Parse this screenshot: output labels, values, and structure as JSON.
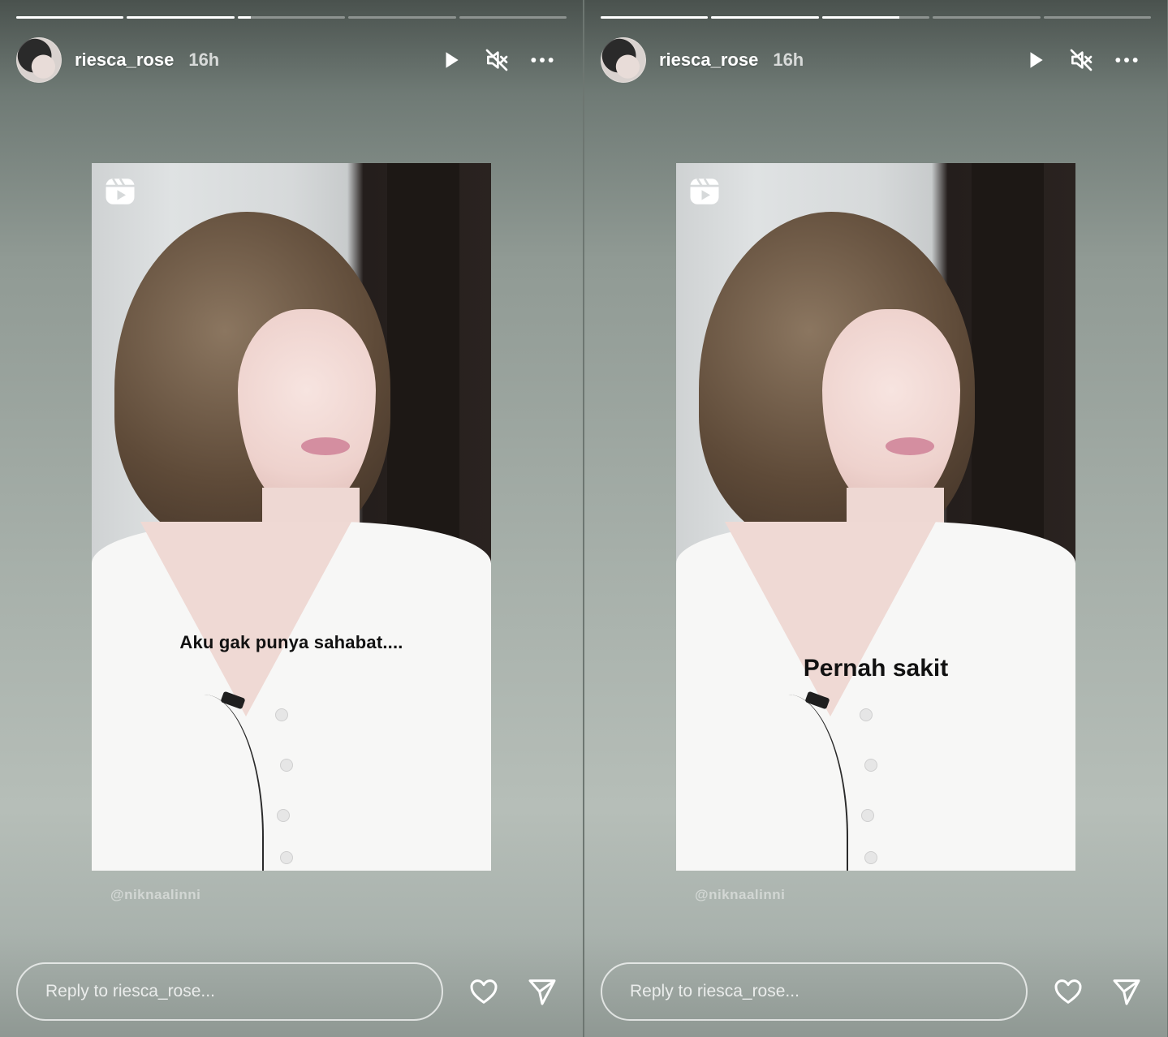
{
  "stories": [
    {
      "username": "riesca_rose",
      "time": "16h",
      "progress": [
        1,
        1,
        0.12,
        0,
        0
      ],
      "caption": "Aku gak punya sahabat....",
      "watermark": "@niknaalinni",
      "reply_placeholder": "Reply to riesca_rose...",
      "icons": [
        "play-icon",
        "mute-icon",
        "more-icon",
        "reels-icon",
        "heart-icon",
        "send-icon"
      ]
    },
    {
      "username": "riesca_rose",
      "time": "16h",
      "progress": [
        1,
        1,
        0.72,
        0,
        0
      ],
      "caption": "Pernah sakit",
      "watermark": "@niknaalinni",
      "reply_placeholder": "Reply to riesca_rose...",
      "icons": [
        "play-icon",
        "mute-icon",
        "more-icon",
        "reels-icon",
        "heart-icon",
        "send-icon"
      ]
    }
  ],
  "colors": {
    "text": "#ffffff",
    "caption": "#111111"
  }
}
